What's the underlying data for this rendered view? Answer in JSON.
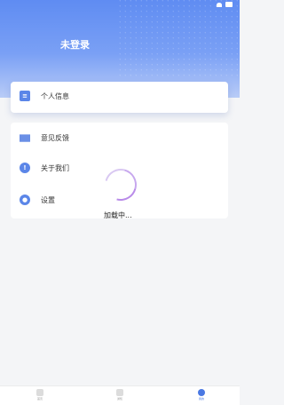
{
  "header": {
    "title": "未登录"
  },
  "cards": {
    "profile": {
      "label": "个人信息"
    },
    "items": [
      {
        "label": "意见反馈",
        "icon": "mail-icon"
      },
      {
        "label": "关于我们",
        "icon": "info-icon"
      },
      {
        "label": "设置",
        "icon": "gear-icon"
      }
    ]
  },
  "loading": {
    "text": "加载中..."
  },
  "tabbar": {
    "tabs": [
      {
        "label": "首页"
      },
      {
        "label": "通知"
      },
      {
        "label": "我的"
      }
    ]
  },
  "colors": {
    "accent": "#4a78e3",
    "header_top": "#5f8cf2"
  }
}
